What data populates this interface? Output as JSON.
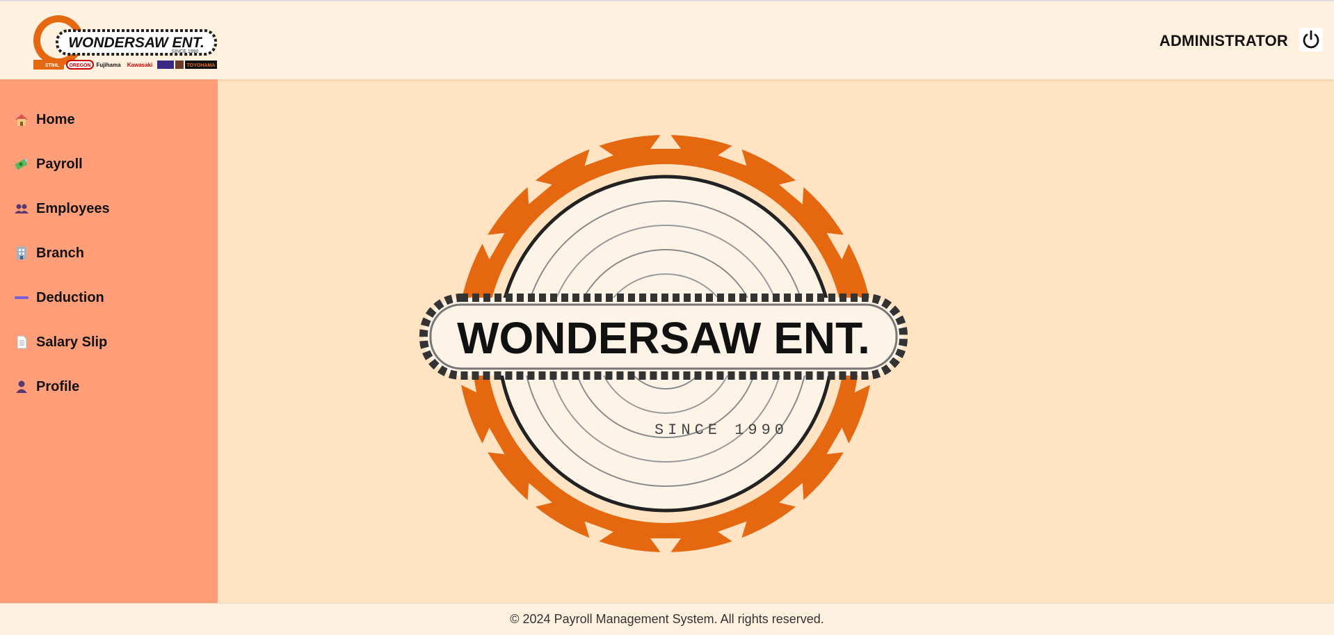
{
  "header": {
    "logo_text": "WONDERSAW ENT.",
    "logo_since": "SINCE 1990",
    "logo_brands": [
      "STIHL",
      "OREGON",
      "Fujihama",
      "Kawasaki",
      "TOYOHAMA"
    ],
    "user_label": "ADMINISTRATOR",
    "logout_icon": "power-icon"
  },
  "sidebar": {
    "items": [
      {
        "label": "Home",
        "icon": "house-icon"
      },
      {
        "label": "Payroll",
        "icon": "money-icon"
      },
      {
        "label": "Employees",
        "icon": "people-icon"
      },
      {
        "label": "Branch",
        "icon": "building-icon"
      },
      {
        "label": "Deduction",
        "icon": "minus-icon"
      },
      {
        "label": "Salary Slip",
        "icon": "document-icon"
      },
      {
        "label": "Profile",
        "icon": "person-icon"
      }
    ]
  },
  "main": {
    "logo_text": "WONDERSAW ENT.",
    "logo_since": "SINCE 1990"
  },
  "footer": {
    "text": "© 2024 Payroll Management System. All rights reserved."
  },
  "colors": {
    "header_bg": "#fff1de",
    "sidebar_bg": "#ff9e78",
    "main_bg": "#ffe3c2",
    "saw_orange": "#e5670f"
  }
}
